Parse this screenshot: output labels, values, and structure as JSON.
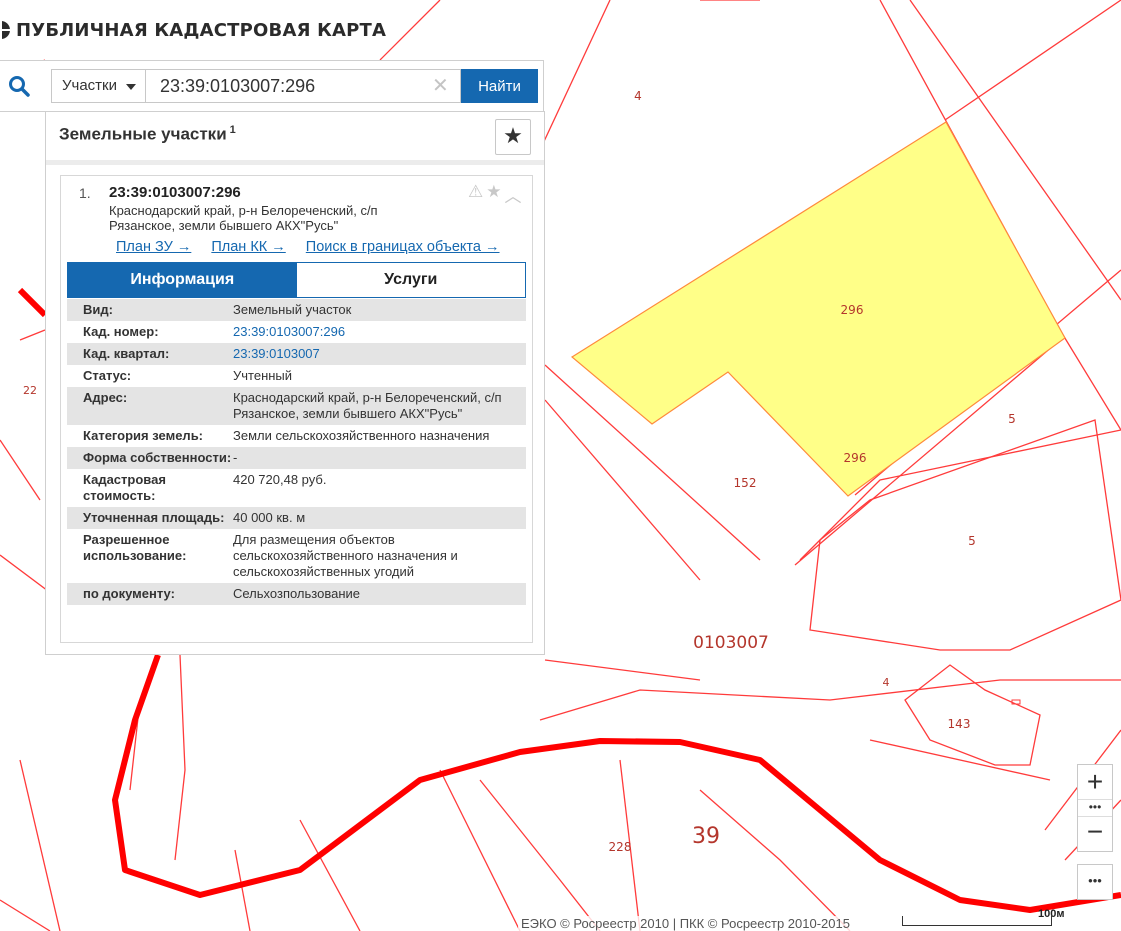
{
  "header": {
    "title": "ПУБЛИЧНАЯ КАДАСТРОВАЯ КАРТА"
  },
  "search": {
    "type_label": "Участки",
    "query": "23:39:0103007:296",
    "button_label": "Найти"
  },
  "panel": {
    "title": "Земельные участки",
    "count": "1",
    "item": {
      "number": "1.",
      "title": "23:39:0103007:296",
      "address": "Краснодарский край, р-н Белореченский, с/п Рязанское, земли бывшего АКХ\"Русь\"",
      "links": [
        "План ЗУ →",
        "План КК →",
        "Поиск в границах объекта →"
      ],
      "tabs": [
        "Информация",
        "Услуги"
      ],
      "rows": [
        {
          "label": "Вид:",
          "value": "Земельный участок"
        },
        {
          "label": "Кад. номер:",
          "value": "23:39:0103007:296"
        },
        {
          "label": "Кад. квартал:",
          "value": "23:39:0103007"
        },
        {
          "label": "Статус:",
          "value": "Учтенный"
        },
        {
          "label": "Адрес:",
          "value": "Краснодарский край, р-н Белореченский, с/п Рязанское, земли бывшего АКХ\"Русь\""
        },
        {
          "label": "Категория земель:",
          "value": "Земли сельскохозяйственного назначения"
        },
        {
          "label": "Форма собственности:",
          "value": "-"
        },
        {
          "label": "Кадастровая стоимость:",
          "value": "420 720,48 руб."
        },
        {
          "label": "Уточненная площадь:",
          "value": "40 000 кв. м"
        },
        {
          "label": "Разрешенное использование:",
          "value": "Для размещения объектов сельскохозяйственного назначения и сельскохозяйственных угодий"
        },
        {
          "label": "по документу:",
          "value": "Сельхозпользование"
        }
      ]
    }
  },
  "map": {
    "labels": {
      "parcel_296_a": "296",
      "parcel_296_b": "296",
      "parcel_4": "4",
      "parcel_5_a": "5",
      "parcel_5_b": "5",
      "parcel_152": "152",
      "quarter": "0103007",
      "parcel_4_b": "4",
      "parcel_143": "143",
      "parcel_228": "228",
      "district": "39",
      "parcel_22": "22"
    },
    "colors": {
      "parcel_fill": "#ffff88",
      "boundary": "#ff3b3b",
      "district_boundary": "#ff0000"
    }
  },
  "footer": {
    "attribution": "ЕЭКО © Росреестр 2010 | ПКК © Росреестр 2010-2015",
    "scale": "100м"
  },
  "controls": {
    "zoom_in": "+",
    "zoom_out": "−",
    "dots": "•••",
    "more": "•••"
  }
}
